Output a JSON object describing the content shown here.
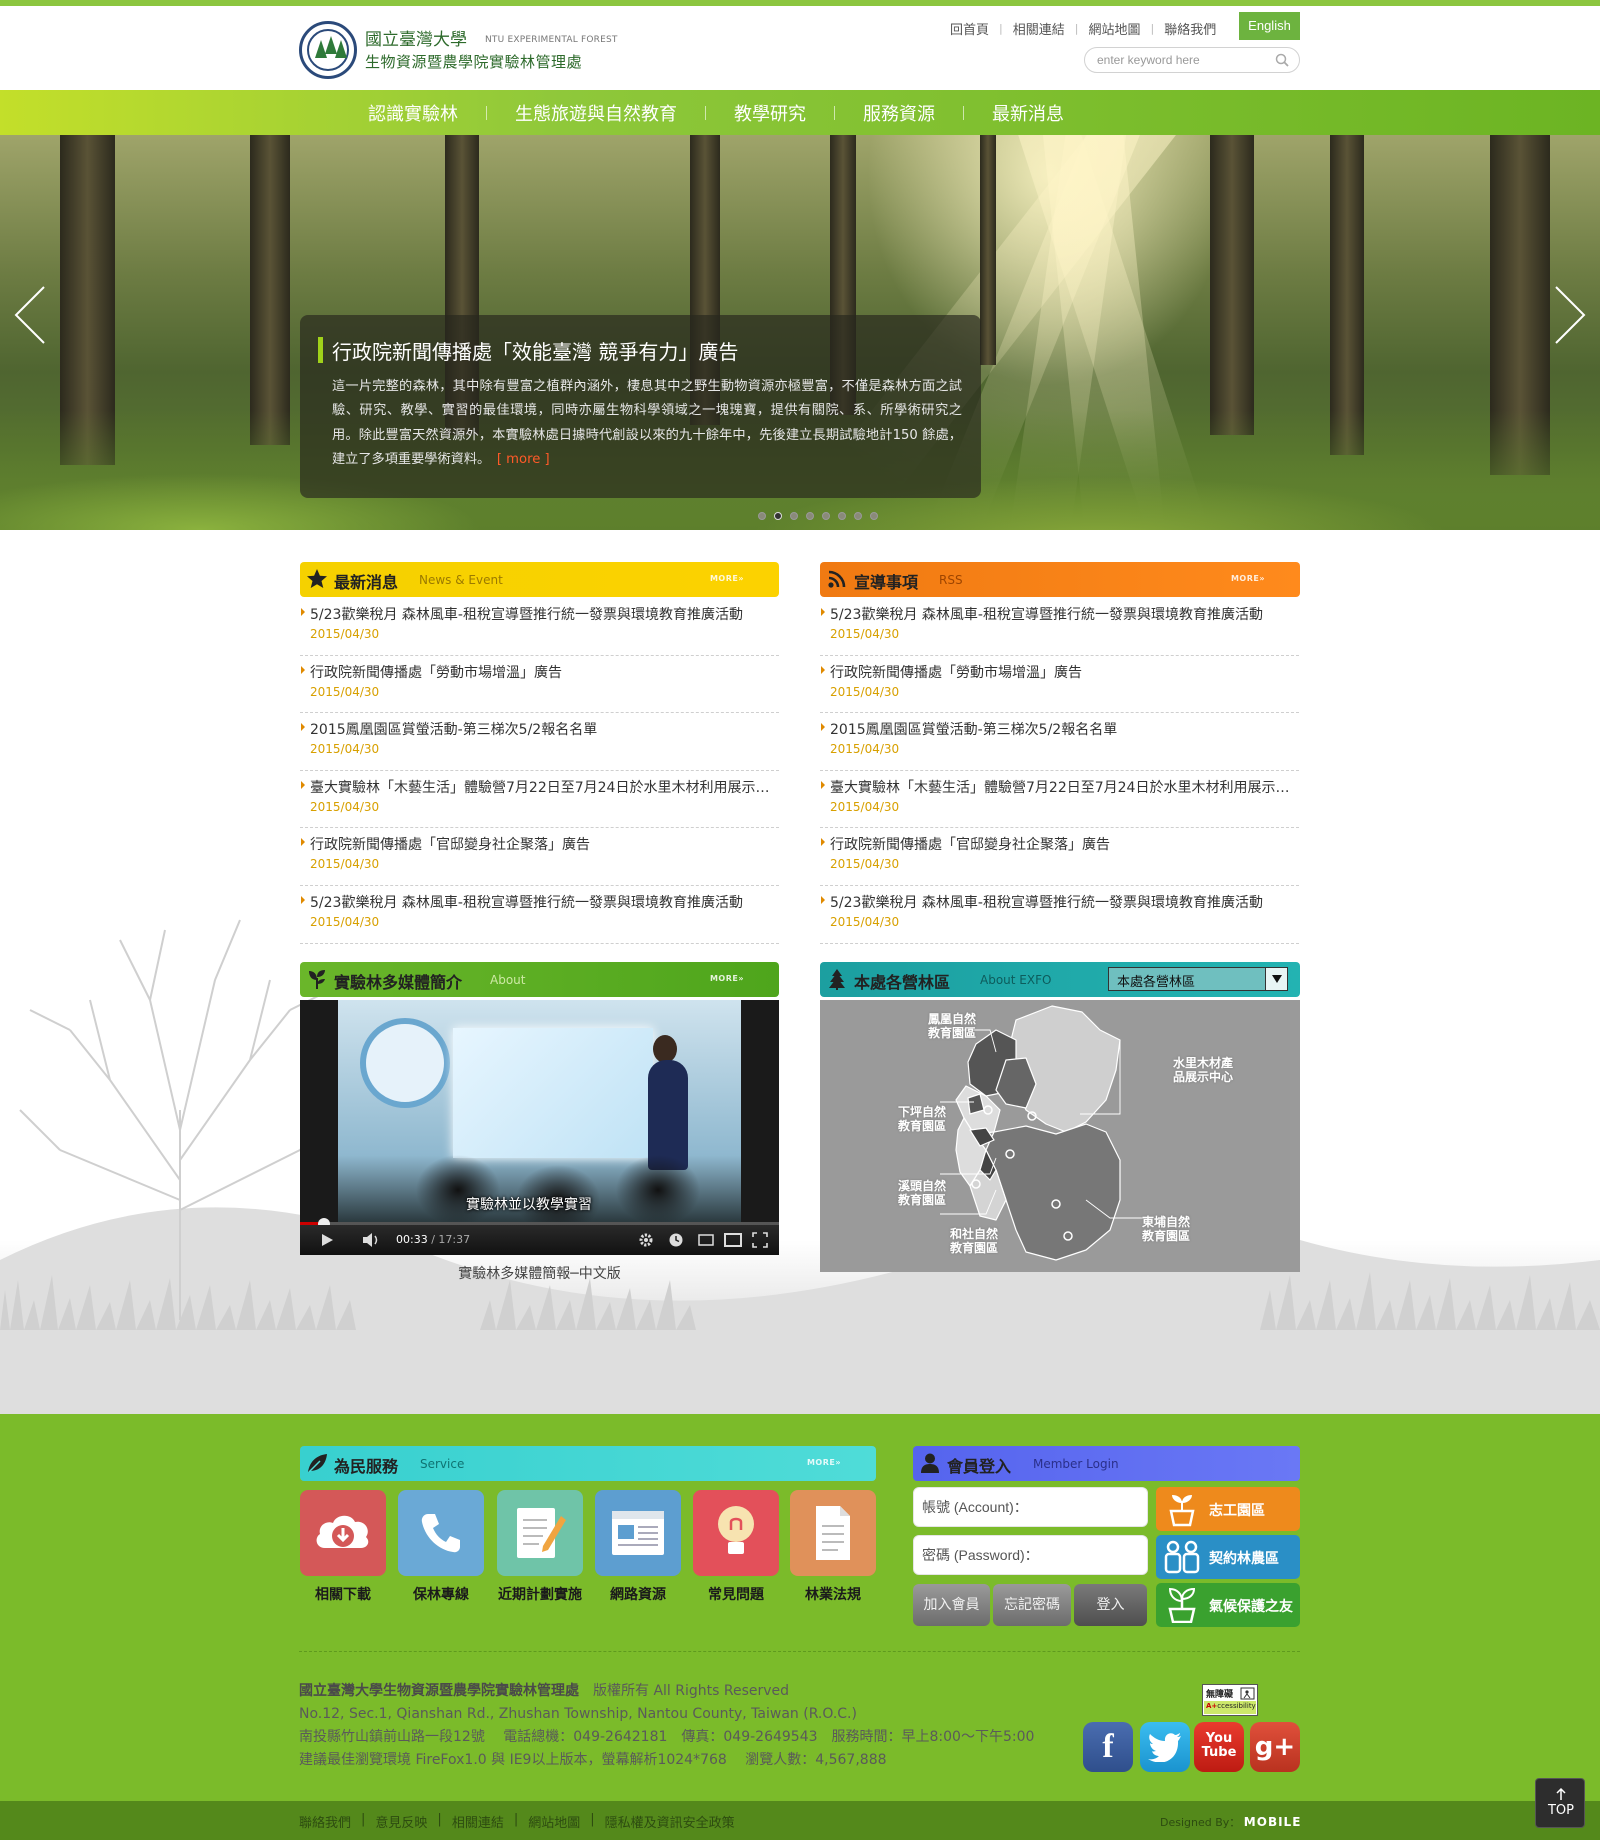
{
  "header": {
    "logo_line1": "國立臺灣大學",
    "logo_sub": "NTU EXPERIMENTAL FOREST",
    "logo_line2": "生物資源暨農學院實驗林管理處",
    "top_links": [
      "回首頁",
      "相關連結",
      "網站地圖",
      "聯絡我們"
    ],
    "lang_button": "English",
    "search_placeholder": "enter keyword here"
  },
  "nav": {
    "items": [
      "認識實驗林",
      "生態旅遊與自然教育",
      "教學研究",
      "服務資源",
      "最新消息"
    ]
  },
  "hero": {
    "title": "行政院新聞傳播處「效能臺灣 競爭有力」廣告",
    "text": "這一片完整的森林，其中除有豐富之植群內涵外，棲息其中之野生動物資源亦極豐富，不僅是森林方面之試驗、研究、教學、實習的最佳環境，同時亦屬生物科學領域之一塊瑰寶，提供有關院、系、所學術研究之用。除此豐富天然資源外，本實驗林處日據時代創設以來的九十餘年中，先後建立長期試驗地計150 餘處，建立了多項重要學術資料。",
    "more_label": "[ more ]",
    "slide_count": 8,
    "active_slide": 2
  },
  "news": {
    "title": "最新消息",
    "subtitle": "News & Event",
    "more": "MORE",
    "items": [
      {
        "title": "5/23歡樂稅月 森林風車-租稅宣導暨推行統一發票與環境教育推廣活動",
        "date": "2015/04/30"
      },
      {
        "title": "行政院新聞傳播處「勞動市場增溫」廣告",
        "date": "2015/04/30"
      },
      {
        "title": "2015鳳凰園區賞螢活動-第三梯次5/2報名名單",
        "date": "2015/04/30"
      },
      {
        "title": "臺大實驗林「木藝生活」體驗營7月22日至7月24日於水里木材利用展示中心",
        "date": "2015/04/30"
      },
      {
        "title": "行政院新聞傳播處「官邸變身社企聚落」廣告",
        "date": "2015/04/30"
      },
      {
        "title": "5/23歡樂稅月 森林風車-租稅宣導暨推行統一發票與環境教育推廣活動",
        "date": "2015/04/30"
      }
    ]
  },
  "rss": {
    "title": "宣導事項",
    "subtitle": "RSS",
    "more": "MORE",
    "items": [
      {
        "title": "5/23歡樂稅月 森林風車-租稅宣導暨推行統一發票與環境教育推廣活動",
        "date": "2015/04/30"
      },
      {
        "title": "行政院新聞傳播處「勞動市場增溫」廣告",
        "date": "2015/04/30"
      },
      {
        "title": "2015鳳凰園區賞螢活動-第三梯次5/2報名名單",
        "date": "2015/04/30"
      },
      {
        "title": "臺大實驗林「木藝生活」體驗營7月22日至7月24日於水里木材利用展示中心",
        "date": "2015/04/30"
      },
      {
        "title": "行政院新聞傳播處「官邸變身社企聚落」廣告",
        "date": "2015/04/30"
      },
      {
        "title": "5/23歡樂稅月 森林風車-租稅宣導暨推行統一發票與環境教育推廣活動",
        "date": "2015/04/30"
      }
    ]
  },
  "media": {
    "title": "實驗林多媒體簡介",
    "subtitle": "About",
    "more": "MORE",
    "video_subtitle": "實驗林並以教學實習",
    "current_time": "00:33",
    "duration": "/ 17:37",
    "caption": "實驗林多媒體簡報─中文版"
  },
  "areas": {
    "title": "本處各營林區",
    "subtitle": "About EXFO",
    "select_value": "本處各營林區",
    "labels": {
      "fenghuang": "鳳凰自然\n教育園區",
      "shuili": "水里木材產\n品展示中心",
      "xiaping": "下坪自然\n教育園區",
      "xitou": "溪頭自然\n教育園區",
      "heshe": "和社自然\n教育園區",
      "dongpu": "東埔自然\n教育園區"
    }
  },
  "service": {
    "title": "為民服務",
    "subtitle": "Service",
    "more": "MORE",
    "items": [
      {
        "label": "相關下載",
        "icon": "download-cloud-icon",
        "color": "#d45858"
      },
      {
        "label": "保林專線",
        "icon": "phone-icon",
        "color": "#6aa9d6"
      },
      {
        "label": "近期計劃實施",
        "icon": "edit-note-icon",
        "color": "#6fc4a8"
      },
      {
        "label": "網路資源",
        "icon": "browser-icon",
        "color": "#5d9ed0"
      },
      {
        "label": "常見問題",
        "icon": "lightbulb-icon",
        "color": "#e3505a"
      },
      {
        "label": "林業法規",
        "icon": "document-icon",
        "color": "#e0915a"
      }
    ]
  },
  "member": {
    "title": "會員登入",
    "subtitle": "Member Login",
    "account_placeholder": "帳號 (Account)：",
    "password_placeholder": "密碼 (Password)：",
    "join": "加入會員",
    "forgot": "忘記密碼",
    "login": "登入",
    "side_buttons": [
      {
        "label": "志工園區",
        "icon": "sprout-icon",
        "color": "#ee8a1c"
      },
      {
        "label": "契約林農區",
        "icon": "people-icon",
        "color": "#2a8fc6"
      },
      {
        "label": "氣候保護之友",
        "icon": "plant-pot-icon",
        "color": "#3aa12f"
      }
    ]
  },
  "footer": {
    "org": "國立臺灣大學生物資源暨農學院實驗林管理處",
    "rights": "版權所有 All Rights Reserved",
    "address_en": "No.12, Sec.1, Qianshan Rd., Zhushan Township, Nantou County, Taiwan (R.O.C.)",
    "address_zh": "南投縣竹山鎮前山路一段12號　 電話總機：049-2642181　傳真：049-2649543　服務時間：早上8:00～下午5:00",
    "browser_note": "建議最佳瀏覽環境 FireFox1.0 與 IE9以上版本，螢幕解析1024*768　 瀏覽人數：4,567,888",
    "a11y_badge": "無障礙 A+ccessibility",
    "social": [
      {
        "name": "facebook",
        "glyph": "f",
        "color": "#3b5998"
      },
      {
        "name": "twitter",
        "glyph": "t",
        "color": "#2aa9e0"
      },
      {
        "name": "youtube",
        "glyph": "You Tube",
        "color": "#d92b20"
      },
      {
        "name": "google-plus",
        "glyph": "g+",
        "color": "#d3412e"
      }
    ],
    "bottom_links": [
      "聯絡我們",
      "意見反映",
      "相關連結",
      "網站地圖",
      "隱私權及資訊安全政策"
    ],
    "designed_by": "Designed By：",
    "designer": "MOBILE",
    "top_button": "TOP"
  },
  "colors": {
    "brand_green": "#7bbb2a",
    "news_yellow": "#f7c600",
    "rss_orange": "#f07a12",
    "media_green": "#5aab22",
    "map_teal": "#1fa8a8",
    "service_teal": "#3fd0cf",
    "member_blue": "#5f6ef0"
  }
}
